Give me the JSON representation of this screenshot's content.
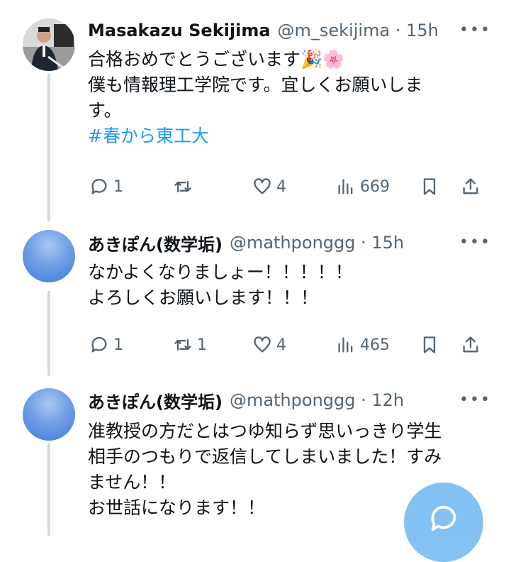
{
  "tweets": [
    {
      "name": "Masakazu Sekijima",
      "handle_time": "@m_sekijima · 15h",
      "lines": [
        "合格おめでとうございます🎉🌸",
        "僕も情報理工学院です。宜しくお願いしま",
        "す。"
      ],
      "hashtag": "#春から東工大",
      "reply_count": "1",
      "retweet_count": "",
      "like_count": "4",
      "view_count": "669",
      "avatar": "photo"
    },
    {
      "name": "あきぽん(数学垢)",
      "handle_time": "@mathponggg · 15h",
      "lines": [
        "なかよくなりましょー！！！！！",
        "よろしくお願いします！！！"
      ],
      "reply_count": "1",
      "retweet_count": "1",
      "like_count": "4",
      "view_count": "465",
      "avatar": "blue-circle"
    },
    {
      "name": "あきぽん(数学垢)",
      "handle_time": "@mathponggg · 12h",
      "lines": [
        "准教授の方だとはつゆ知らず思いっきり学生",
        "相手のつもりで返信してしまいました！すみ",
        "ません！！",
        "お世話になります！！"
      ],
      "avatar": "blue-circle"
    }
  ],
  "more_label": "•••",
  "colors": {
    "accent": "#1d9bf0",
    "muted": "#536471",
    "text": "#0f1419",
    "thread_line": "#cfd9de"
  },
  "icons": [
    "reply-icon",
    "retweet-icon",
    "like-icon",
    "views-icon",
    "bookmark-icon",
    "share-icon",
    "compose-reply-icon"
  ]
}
